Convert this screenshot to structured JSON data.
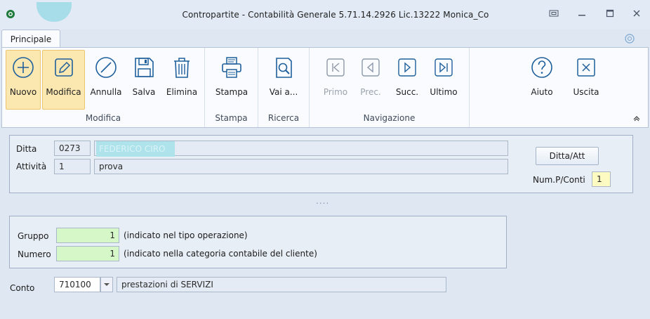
{
  "window": {
    "title": "Contropartite - Contabilità Generale 5.71.14.2926 Lic.13222 Monica_Co"
  },
  "tabs": [
    {
      "label": "Principale",
      "active": true
    }
  ],
  "ribbon": {
    "groups": [
      {
        "label": "Modifica",
        "buttons": [
          {
            "label": "Nuovo",
            "icon": "plus-circle-icon",
            "active": true
          },
          {
            "label": "Modifica",
            "icon": "pencil-icon",
            "active": true
          },
          {
            "label": "Annulla",
            "icon": "cancel-circle-icon"
          },
          {
            "label": "Salva",
            "icon": "floppy-disk-icon"
          },
          {
            "label": "Elimina",
            "icon": "trash-icon"
          }
        ]
      },
      {
        "label": "Stampa",
        "buttons": [
          {
            "label": "Stampa",
            "icon": "printer-icon"
          }
        ]
      },
      {
        "label": "Ricerca",
        "buttons": [
          {
            "label": "Vai a...",
            "icon": "search-doc-icon"
          }
        ]
      },
      {
        "label": "Navigazione",
        "buttons": [
          {
            "label": "Primo",
            "icon": "first-icon",
            "disabled": true
          },
          {
            "label": "Prec.",
            "icon": "prev-icon",
            "disabled": true
          },
          {
            "label": "Succ.",
            "icon": "next-icon"
          },
          {
            "label": "Ultimo",
            "icon": "last-icon"
          }
        ]
      },
      {
        "label": "",
        "buttons": [
          {
            "label": "Aiuto",
            "icon": "help-icon"
          },
          {
            "label": "Uscita",
            "icon": "close-box-icon"
          }
        ]
      }
    ]
  },
  "header_panel": {
    "ditta_label": "Ditta",
    "ditta_code": "0273",
    "ditta_name": "FEDERICO CIRO",
    "attivita_label": "Attività",
    "attivita_code": "1",
    "attivita_desc": "prova",
    "ditta_att_button": "Ditta/Att",
    "num_pconti_label": "Num.P/Conti",
    "num_pconti_value": "1"
  },
  "splitter": "....",
  "group_panel": {
    "gruppo_label": "Gruppo",
    "gruppo_value": "1",
    "gruppo_note": "(indicato nel tipo operazione)",
    "numero_label": "Numero",
    "numero_value": "1",
    "numero_note": "(indicato nella categoria contabile del cliente)"
  },
  "conto": {
    "label": "Conto",
    "code": "710100",
    "desc": "prestazioni di SERVIZI"
  },
  "colors": {
    "titlebar_bg": "#e2eaf5",
    "ribbon_bg": "#f9fbfe",
    "active_button_bg": "#fbe7b0",
    "icon_blue": "#1e5f9c",
    "green_field": "#d6f8c9",
    "yellow_field": "#fdfbc2",
    "content_bg": "#dfe7f2"
  }
}
